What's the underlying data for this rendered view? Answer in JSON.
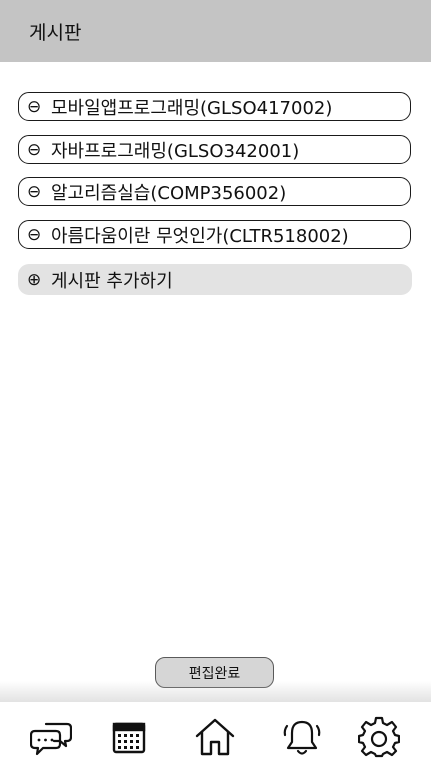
{
  "header": {
    "title": "게시판"
  },
  "boards": [
    {
      "symbol": "⊖",
      "label": "모바일앱프로그래밍(GLSO417002)"
    },
    {
      "symbol": "⊖",
      "label": "자바프로그래밍(GLSO342001)"
    },
    {
      "symbol": "⊖",
      "label": "알고리즘실습(COMP356002)"
    },
    {
      "symbol": "⊖",
      "label": "아름다움이란 무엇인가(CLTR518002)"
    }
  ],
  "add_board": {
    "symbol": "⊕",
    "label": "게시판 추가하기"
  },
  "done_button": {
    "label": "편집완료"
  },
  "nav": {
    "items": [
      {
        "icon": "chat-icon"
      },
      {
        "icon": "calendar-icon"
      },
      {
        "icon": "home-icon"
      },
      {
        "icon": "bell-icon"
      },
      {
        "icon": "gear-icon"
      }
    ]
  },
  "colors": {
    "header_bg": "#c4c4c4",
    "add_bg": "#e3e3e3",
    "button_bg": "#d6d6d6"
  }
}
